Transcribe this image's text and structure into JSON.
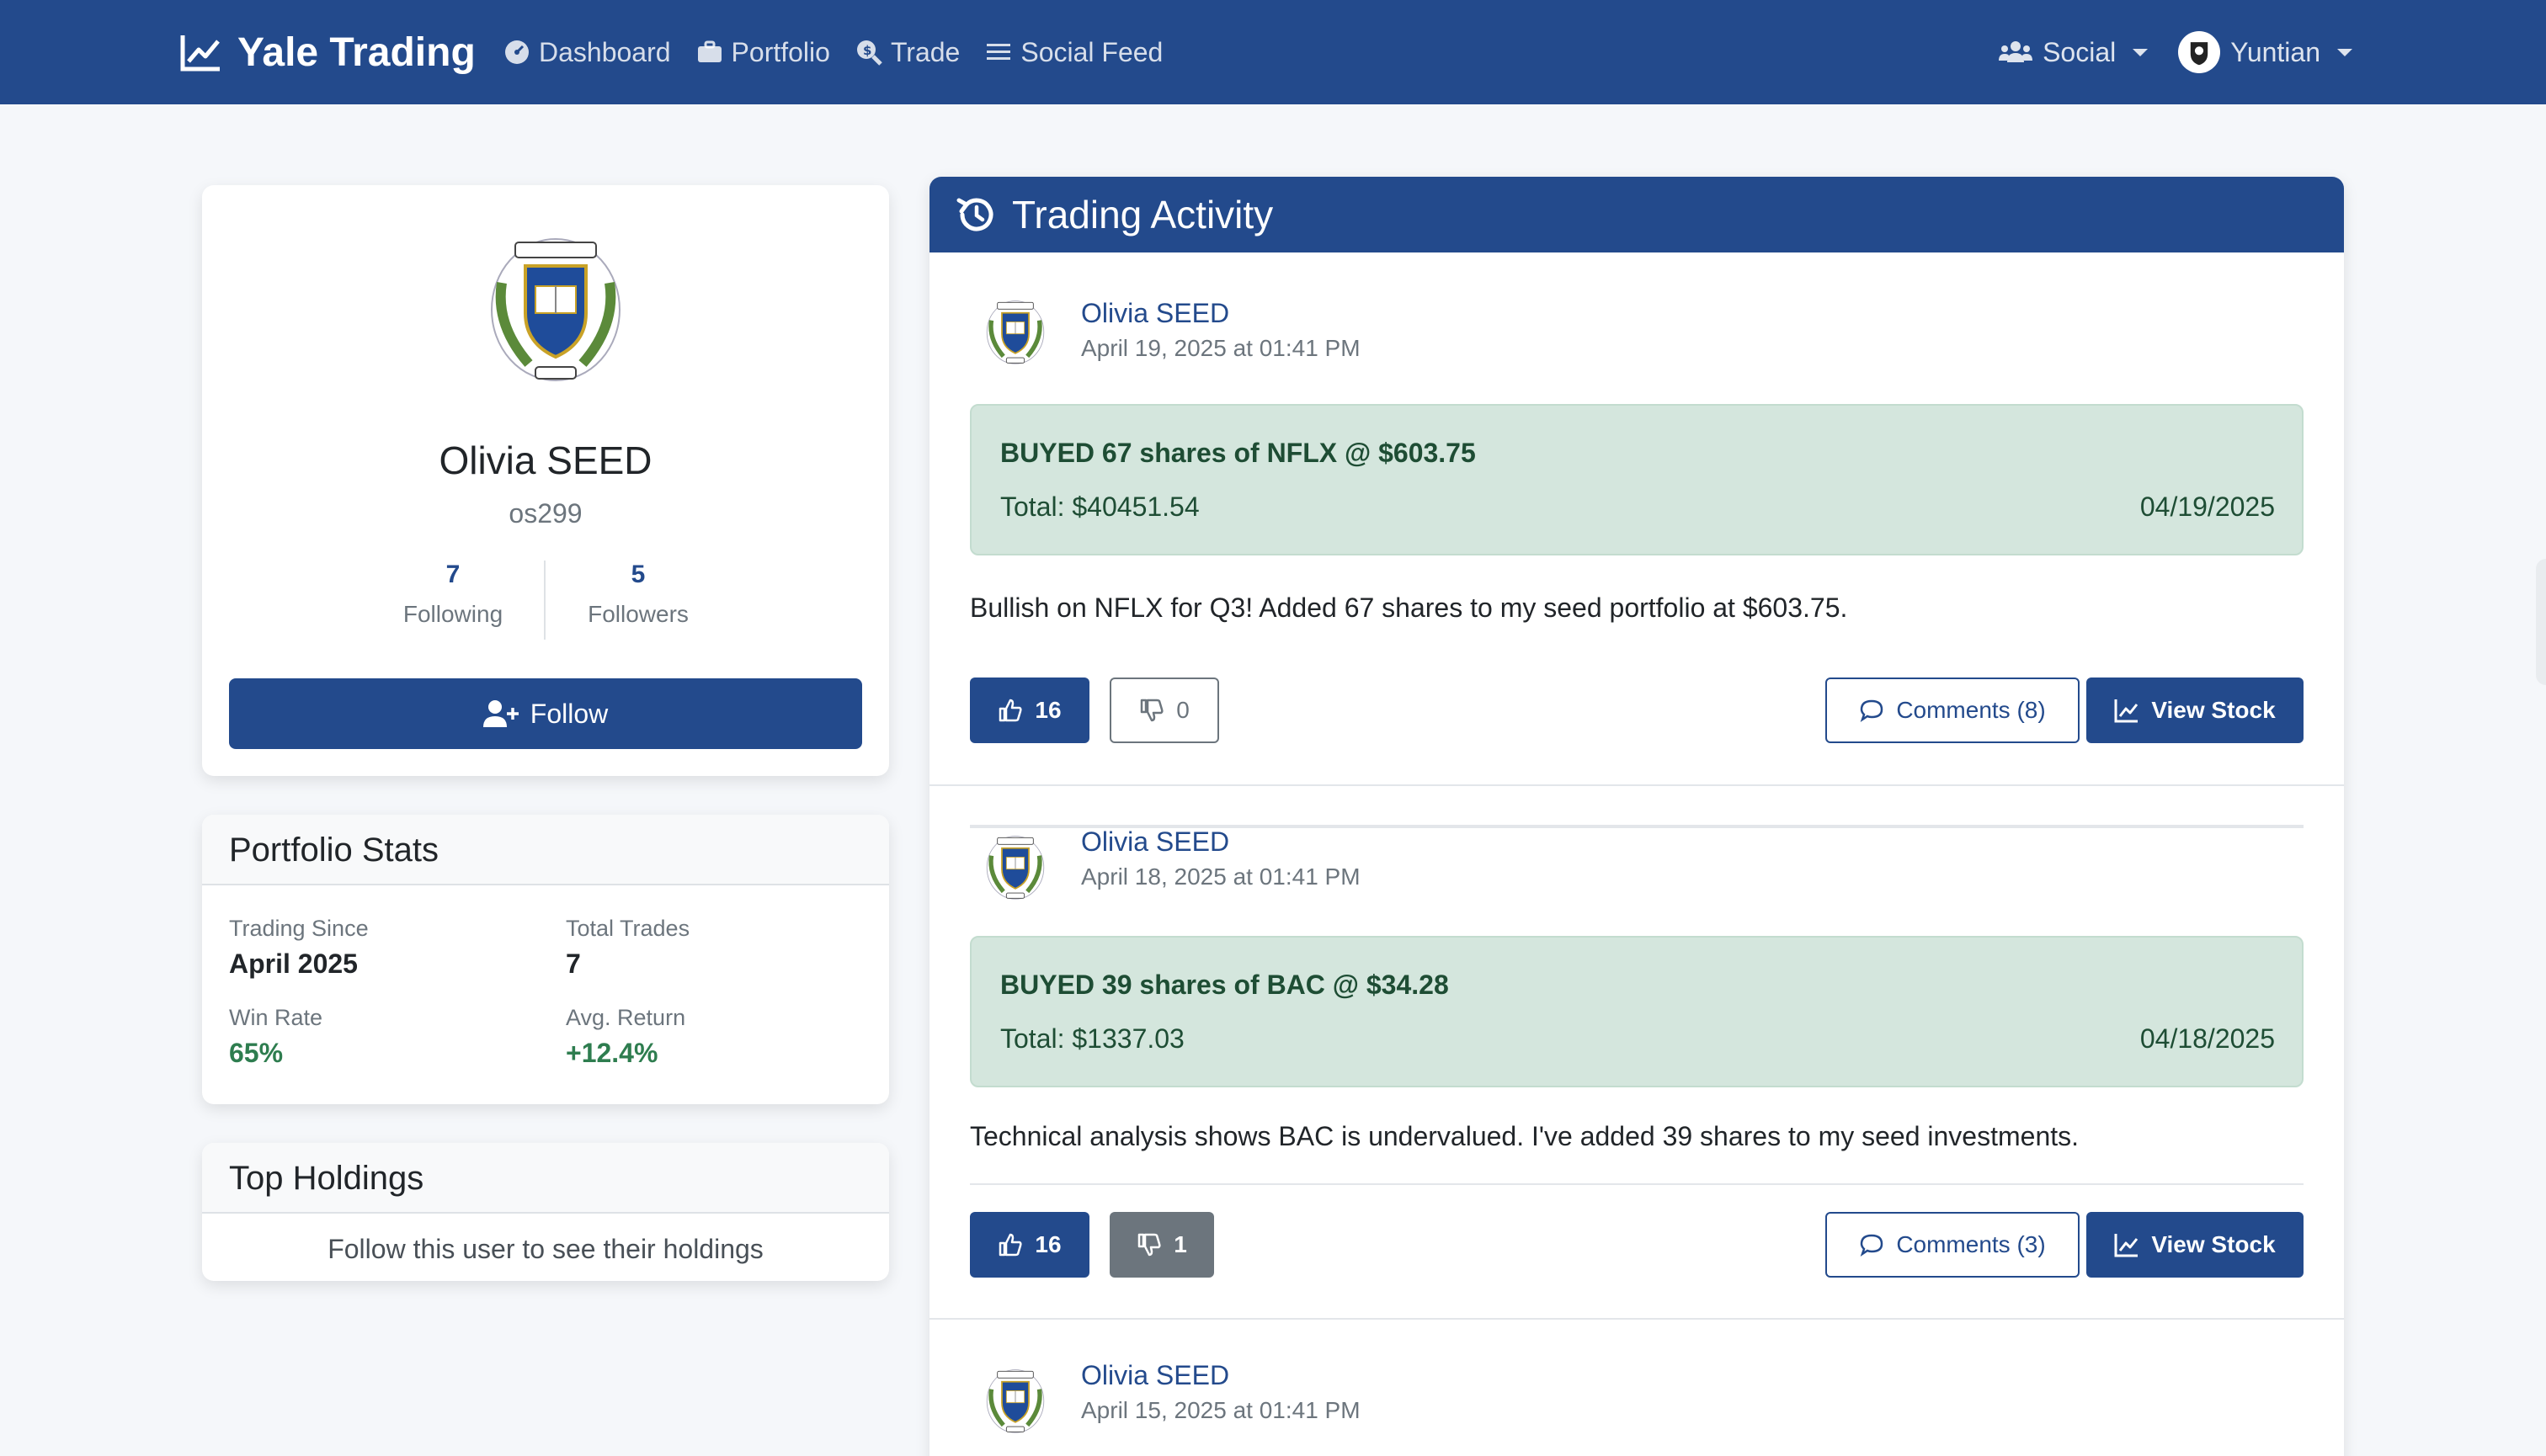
{
  "colors": {
    "primary": "#234a8c",
    "trade_bg": "#d4e6dd",
    "trade_text": "#1e4d34",
    "positive": "#2e7d4f",
    "muted": "#6c757d"
  },
  "navbar": {
    "brand": "Yale Trading",
    "links": [
      {
        "label": "Dashboard",
        "icon": "gauge-icon"
      },
      {
        "label": "Portfolio",
        "icon": "briefcase-icon"
      },
      {
        "label": "Trade",
        "icon": "search-dollar-icon"
      },
      {
        "label": "Social Feed",
        "icon": "list-icon"
      }
    ],
    "social_label": "Social",
    "user_label": "Yuntian"
  },
  "profile": {
    "name": "Olivia SEED",
    "username": "os299",
    "following_count": "7",
    "following_label": "Following",
    "followers_count": "5",
    "followers_label": "Followers",
    "follow_button": "Follow"
  },
  "portfolio_stats": {
    "title": "Portfolio Stats",
    "trading_since_label": "Trading Since",
    "trading_since_value": "April 2025",
    "total_trades_label": "Total Trades",
    "total_trades_value": "7",
    "win_rate_label": "Win Rate",
    "win_rate_value": "65%",
    "avg_return_label": "Avg. Return",
    "avg_return_value": "+12.4%"
  },
  "top_holdings": {
    "title": "Top Holdings",
    "message": "Follow this user to see their holdings"
  },
  "activity": {
    "title": "Trading Activity",
    "posts": [
      {
        "author": "Olivia SEED",
        "time": "April 19, 2025 at 01:41 PM",
        "trade_title": "BUYED 67 shares of NFLX @ $603.75",
        "trade_total": "Total: $40451.54",
        "trade_date": "04/19/2025",
        "text": "Bullish on NFLX for Q3! Added 67 shares to my seed portfolio at $603.75.",
        "likes": "16",
        "dislikes": "0",
        "comments": "Comments (8)",
        "view_stock": "View Stock"
      },
      {
        "author": "Olivia SEED",
        "time": "April 18, 2025 at 01:41 PM",
        "trade_title": "BUYED 39 shares of BAC @ $34.28",
        "trade_total": "Total: $1337.03",
        "trade_date": "04/18/2025",
        "text": "Technical analysis shows BAC is undervalued. I've added 39 shares to my seed investments.",
        "likes": "16",
        "dislikes": "1",
        "comments": "Comments (3)",
        "view_stock": "View Stock"
      },
      {
        "author": "Olivia SEED",
        "time": "April 15, 2025 at 01:41 PM"
      }
    ]
  }
}
